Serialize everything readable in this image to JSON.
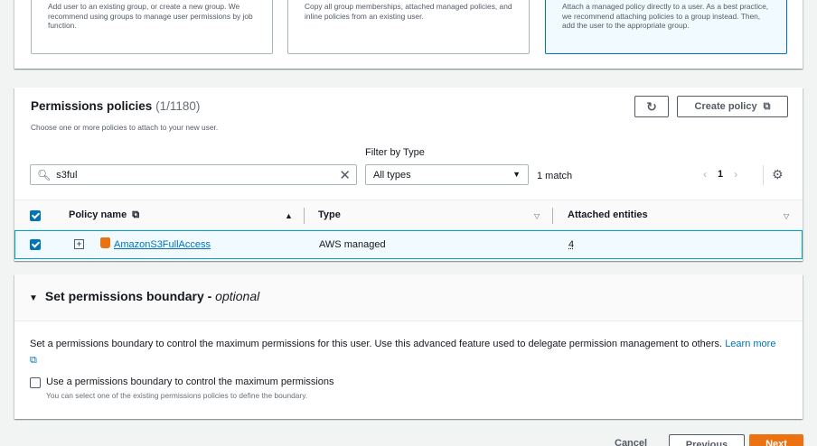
{
  "options": [
    {
      "text": "Add user to an existing group, or create a new group. We recommend using groups to manage user permissions by job function.",
      "selected": false
    },
    {
      "text": "Copy all group memberships, attached managed policies, and inline policies from an existing user.",
      "selected": false
    },
    {
      "text": "Attach a managed policy directly to a user. As a best practice, we recommend attaching policies to a group instead. Then, add the user to the appropriate group.",
      "selected": true
    }
  ],
  "permissions": {
    "title": "Permissions policies",
    "count": "(1/1180)",
    "description": "Choose one or more policies to attach to your new user.",
    "create_policy_label": "Create policy",
    "filter_label": "Filter by Type",
    "search_value": "s3ful",
    "filter_value": "All types",
    "matches": "1 match",
    "page": "1",
    "columns": {
      "policy_name": "Policy name",
      "type": "Type",
      "attached": "Attached entities"
    },
    "rows": [
      {
        "name": "AmazonS3FullAccess",
        "type": "AWS managed",
        "attached": "4",
        "checked": true
      }
    ]
  },
  "boundary": {
    "title": "Set permissions boundary - ",
    "optional": "optional",
    "description": "Set a permissions boundary to control the maximum permissions for this user. Use this advanced feature used to delegate permission management to others.",
    "learn_more": "Learn more",
    "checkbox_label": "Use a permissions boundary to control the maximum permissions",
    "checkbox_sub": "You can select one of the existing permissions policies to define the boundary."
  },
  "footer": {
    "cancel": "Cancel",
    "previous": "Previous",
    "next": "Next"
  },
  "colors": {
    "accent": "#0073bb",
    "primary_button": "#ec7211",
    "selected_bg": "#f1faff"
  }
}
